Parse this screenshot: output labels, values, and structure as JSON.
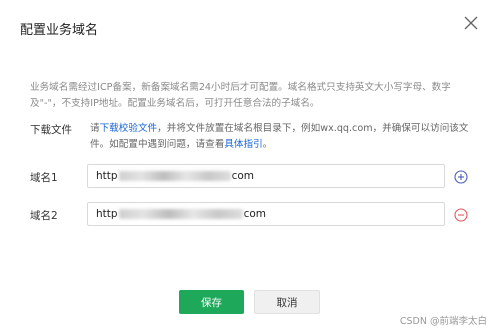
{
  "dialog": {
    "title": "配置业务域名",
    "tip": "业务域名需经过ICP备案，新备案域名需24小时后才可配置。域名格式只支持英文大小写字母、数字及\"-\"，不支持IP地址。配置业务域名后，可打开任意合法的子域名。"
  },
  "download": {
    "label": "下载文件",
    "prefix": "请",
    "link": "下载校验文件",
    "middle": "，并将文件放置在域名根目录下，例如wx.qq.com，并确保可以访问该文件。如配置中遇到问题，请查看",
    "guide_link": "具体指引",
    "suffix": "。"
  },
  "domains": [
    {
      "label": "域名1",
      "value_start": "http",
      "value_end": "com",
      "action_icon": "add-circle-icon",
      "action_color": "#4a5fb5"
    },
    {
      "label": "域名2",
      "value_start": "http",
      "value_end": "com",
      "action_icon": "remove-circle-icon",
      "action_color": "#e05a5a"
    }
  ],
  "footer": {
    "save_label": "保存",
    "cancel_label": "取消"
  },
  "watermark": "CSDN @前端李太白",
  "colors": {
    "primary_button": "#1ea85a",
    "link": "#1a66d6"
  }
}
